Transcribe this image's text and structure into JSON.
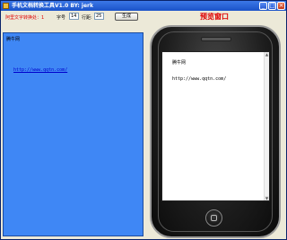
{
  "window": {
    "title": "手机文档转换工具V1.0 BY: jerk",
    "min": "_",
    "max": "□",
    "close": "×"
  },
  "toolbar": {
    "link_text": "阿里文字转换处：1",
    "font_label": "字号",
    "font_value": "14",
    "line_label": "行距:",
    "line_value": "25",
    "generate_button": "生成",
    "preview_title": "预览窗口"
  },
  "editor": {
    "name": "腾牛网",
    "url": "http://www.qqtn.com/"
  },
  "preview": {
    "name": "腾牛网",
    "url": "http://www.qqtn.com/",
    "scroll_up": "▲",
    "scroll_down": "▼"
  },
  "colors": {
    "editor_bg": "#3f87f5",
    "accent_red": "#e00000",
    "title_bar": "#1a52c8"
  }
}
